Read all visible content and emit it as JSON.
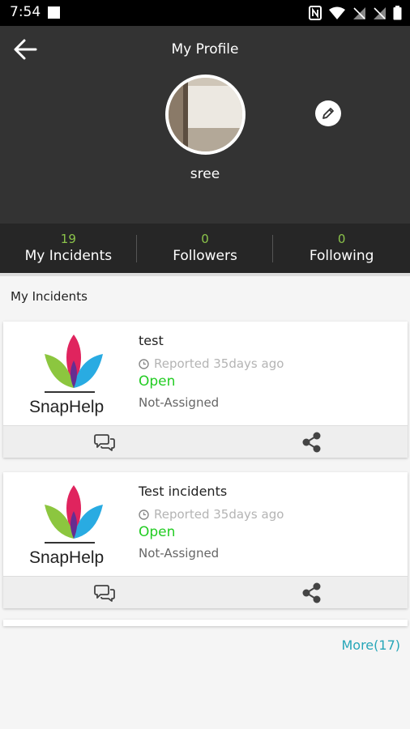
{
  "status_bar": {
    "time": "7:54"
  },
  "header": {
    "title": "My Profile",
    "username": "sree"
  },
  "stats": [
    {
      "count": "19",
      "label": "My Incidents"
    },
    {
      "count": "0",
      "label": "Followers"
    },
    {
      "count": "0",
      "label": "Following"
    }
  ],
  "section": {
    "title": "My Incidents"
  },
  "incidents": [
    {
      "logo_text": "SnapHelp",
      "title": "test",
      "reported": "Reported 35days ago",
      "status": "Open",
      "assignment": "Not-Assigned"
    },
    {
      "logo_text": "SnapHelp",
      "title": "Test incidents",
      "reported": "Reported 35days ago",
      "status": "Open",
      "assignment": "Not-Assigned"
    }
  ],
  "more_link": "More(17)",
  "colors": {
    "header_bg": "#333333",
    "stats_bg": "#262626",
    "count": "#8bc34a",
    "open_status": "#22cc22",
    "more_link": "#26a6b8"
  }
}
